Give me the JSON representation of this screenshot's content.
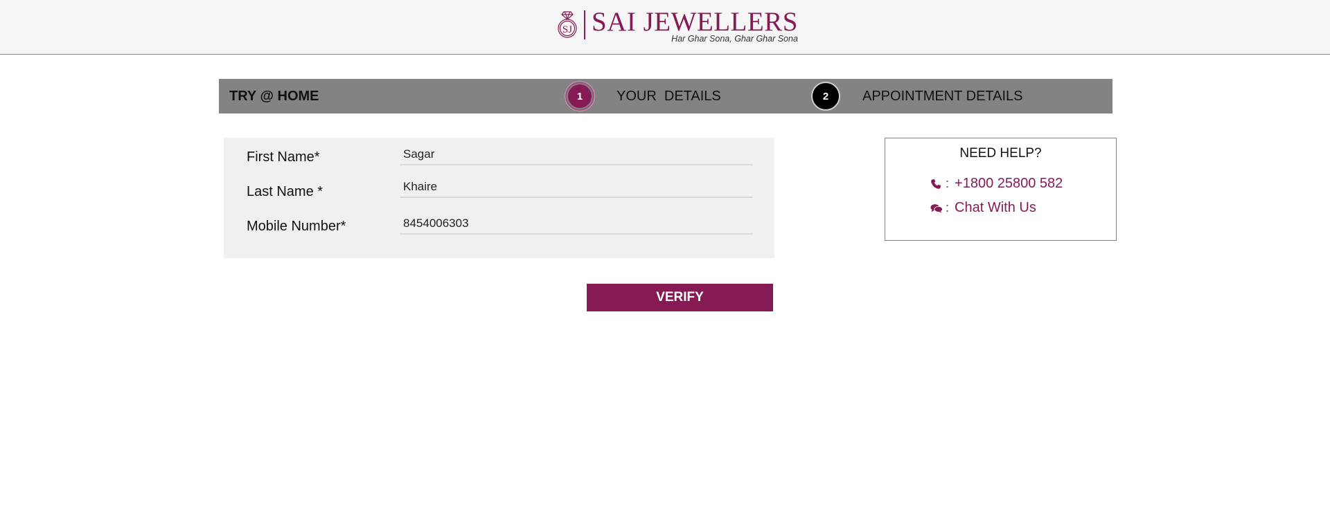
{
  "header": {
    "brand_name": "SAI JEWELLERS",
    "tagline": "Har Ghar Sona, Ghar Ghar Sona",
    "logo_icon": "sj-monogram-logo"
  },
  "steps": {
    "title": "TRY @ HOME",
    "items": [
      {
        "number": "1",
        "label": "YOUR  DETAILS",
        "state": "active"
      },
      {
        "number": "2",
        "label": "APPOINTMENT DETAILS",
        "state": "inactive"
      }
    ]
  },
  "form": {
    "first_name": {
      "label": "First Name*",
      "value": "Sagar"
    },
    "last_name": {
      "label": "Last Name *",
      "value": "Khaire"
    },
    "mobile": {
      "label": "Mobile Number*",
      "value": "8454006303"
    },
    "verify_label": "VERIFY"
  },
  "help": {
    "title": "NEED HELP?",
    "phone": "+1800 25800 582",
    "chat": "Chat With Us",
    "phone_icon": "phone-icon",
    "chat_icon": "chat-bubbles-icon",
    "separator": ":"
  },
  "colors": {
    "brand": "#861a55",
    "steps_bar": "#838385",
    "form_bg": "#f0f0f0",
    "header_bg": "#f5f5f5"
  }
}
